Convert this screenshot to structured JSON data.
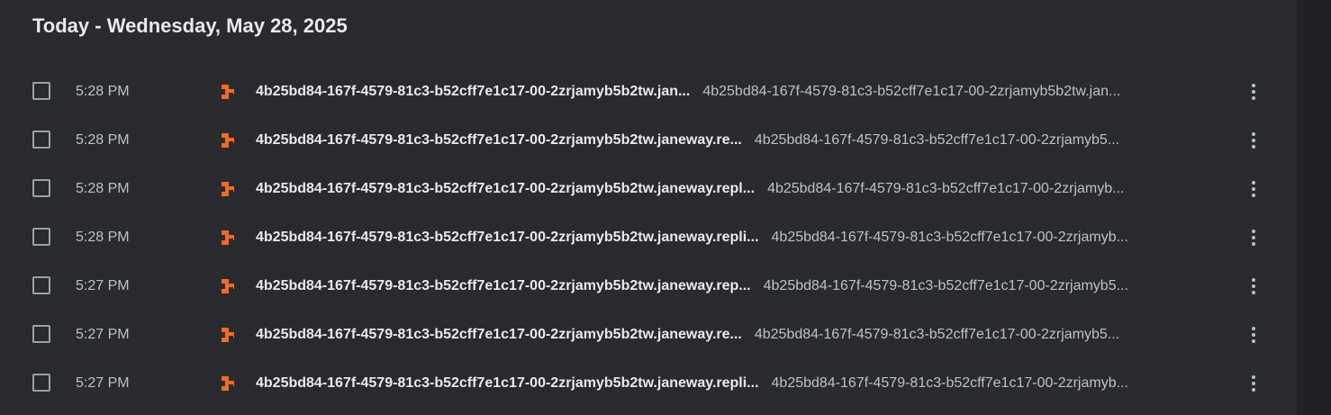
{
  "section": {
    "title": "Today - Wednesday, May 28, 2025"
  },
  "icons": {
    "file": "orange-download-file-icon",
    "more": "vertical-dots-more-icon"
  },
  "colors": {
    "accent": "#f26b1d",
    "background": "#292a2d",
    "text_primary": "#e8eaed",
    "text_secondary": "#bdc1c6"
  },
  "rows": [
    {
      "time": "5:28 PM",
      "name": "4b25bd84-167f-4579-81c3-b52cff7e1c17-00-2zrjamyb5b2tw.jan...",
      "source": "4b25bd84-167f-4579-81c3-b52cff7e1c17-00-2zrjamyb5b2tw.jan..."
    },
    {
      "time": "5:28 PM",
      "name": "4b25bd84-167f-4579-81c3-b52cff7e1c17-00-2zrjamyb5b2tw.janeway.re...",
      "source": "4b25bd84-167f-4579-81c3-b52cff7e1c17-00-2zrjamyb5..."
    },
    {
      "time": "5:28 PM",
      "name": "4b25bd84-167f-4579-81c3-b52cff7e1c17-00-2zrjamyb5b2tw.janeway.repl...",
      "source": "4b25bd84-167f-4579-81c3-b52cff7e1c17-00-2zrjamyb..."
    },
    {
      "time": "5:28 PM",
      "name": "4b25bd84-167f-4579-81c3-b52cff7e1c17-00-2zrjamyb5b2tw.janeway.repli...",
      "source": "4b25bd84-167f-4579-81c3-b52cff7e1c17-00-2zrjamyb..."
    },
    {
      "time": "5:27 PM",
      "name": "4b25bd84-167f-4579-81c3-b52cff7e1c17-00-2zrjamyb5b2tw.janeway.rep...",
      "source": "4b25bd84-167f-4579-81c3-b52cff7e1c17-00-2zrjamyb5..."
    },
    {
      "time": "5:27 PM",
      "name": "4b25bd84-167f-4579-81c3-b52cff7e1c17-00-2zrjamyb5b2tw.janeway.re...",
      "source": "4b25bd84-167f-4579-81c3-b52cff7e1c17-00-2zrjamyb5..."
    },
    {
      "time": "5:27 PM",
      "name": "4b25bd84-167f-4579-81c3-b52cff7e1c17-00-2zrjamyb5b2tw.janeway.repli...",
      "source": "4b25bd84-167f-4579-81c3-b52cff7e1c17-00-2zrjamyb..."
    }
  ]
}
